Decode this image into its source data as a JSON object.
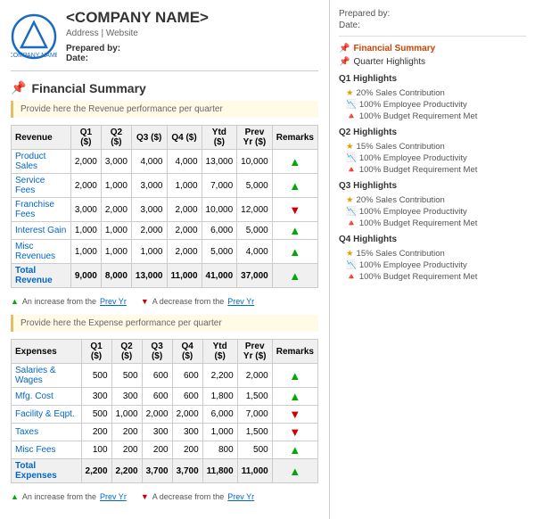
{
  "header": {
    "company_name": "<COMPANY NAME>",
    "address": "Address | Website",
    "prepared_by_label": "Prepared by:",
    "date_label": "Date:",
    "logo_alt": "company-logo"
  },
  "sidebar": {
    "prepared_by_label": "Prepared by:",
    "date_label": "Date:",
    "nav": [
      {
        "id": "financial-summary",
        "label": "Financial Summary",
        "icon": "📌",
        "active": true,
        "indent": 0
      },
      {
        "id": "quarter-highlights",
        "label": "Quarter Highlights",
        "icon": "📌",
        "active": false,
        "indent": 0
      }
    ],
    "quarters": [
      {
        "label": "Q1 Highlights",
        "items": [
          {
            "type": "star",
            "text": "20% Sales Contribution"
          },
          {
            "type": "trend",
            "text": "100% Employee Productivity"
          },
          {
            "type": "warn",
            "text": "100% Budget Requirement Met"
          }
        ]
      },
      {
        "label": "Q2 Highlights",
        "items": [
          {
            "type": "star",
            "text": "15% Sales Contribution"
          },
          {
            "type": "trend",
            "text": "100% Employee Productivity"
          },
          {
            "type": "warn",
            "text": "100% Budget Requirement Met"
          }
        ]
      },
      {
        "label": "Q3 Highlights",
        "items": [
          {
            "type": "star",
            "text": "20% Sales Contribution"
          },
          {
            "type": "trend",
            "text": "100% Employee Productivity"
          },
          {
            "type": "warn",
            "text": "100% Budget Requirement Met"
          }
        ]
      },
      {
        "label": "Q4 Highlights",
        "items": [
          {
            "type": "star",
            "text": "15% Sales Contribution"
          },
          {
            "type": "trend",
            "text": "100% Employee Productivity"
          },
          {
            "type": "warn",
            "text": "100% Budget Requirement Met"
          }
        ]
      }
    ]
  },
  "financial_summary": {
    "title": "Financial Summary",
    "revenue_note": "Provide here the Revenue performance per quarter",
    "revenue_table": {
      "headers": [
        "Revenue",
        "Q1 ($)",
        "Q2 ($)",
        "Q3 ($)",
        "Q4 ($)",
        "Ytd ($)",
        "Prev Yr ($)",
        "Remarks"
      ],
      "rows": [
        {
          "label": "Product Sales",
          "q1": "2,000",
          "q2": "3,000",
          "q3": "4,000",
          "q4": "4,000",
          "ytd": "13,000",
          "prev": "10,000",
          "trend": "up"
        },
        {
          "label": "Service Fees",
          "q1": "2,000",
          "q2": "1,000",
          "q3": "3,000",
          "q4": "1,000",
          "ytd": "7,000",
          "prev": "5,000",
          "trend": "up"
        },
        {
          "label": "Franchise Fees",
          "q1": "3,000",
          "q2": "2,000",
          "q3": "3,000",
          "q4": "2,000",
          "ytd": "10,000",
          "prev": "12,000",
          "trend": "down"
        },
        {
          "label": "Interest Gain",
          "q1": "1,000",
          "q2": "1,000",
          "q3": "2,000",
          "q4": "2,000",
          "ytd": "6,000",
          "prev": "5,000",
          "trend": "up"
        },
        {
          "label": "Misc Revenues",
          "q1": "1,000",
          "q2": "1,000",
          "q3": "1,000",
          "q4": "2,000",
          "ytd": "5,000",
          "prev": "4,000",
          "trend": "up"
        },
        {
          "label": "Total Revenue",
          "q1": "9,000",
          "q2": "8,000",
          "q3": "13,000",
          "q4": "11,000",
          "ytd": "41,000",
          "prev": "37,000",
          "trend": "up",
          "total": true
        }
      ]
    },
    "revenue_marker": {
      "up_text": "An increase from the",
      "up_link": "Prev Yr",
      "down_text": "A decrease from the",
      "down_link": "Prev Yr"
    },
    "expense_note": "Provide here the Expense performance per quarter",
    "expense_table": {
      "headers": [
        "Expenses",
        "Q1 ($)",
        "Q2 ($)",
        "Q3 ($)",
        "Q4 ($)",
        "Ytd ($)",
        "Prev Yr ($)",
        "Remarks"
      ],
      "rows": [
        {
          "label": "Salaries & Wages",
          "q1": "500",
          "q2": "500",
          "q3": "600",
          "q4": "600",
          "ytd": "2,200",
          "prev": "2,000",
          "trend": "up"
        },
        {
          "label": "Mfg. Cost",
          "q1": "300",
          "q2": "300",
          "q3": "600",
          "q4": "600",
          "ytd": "1,800",
          "prev": "1,500",
          "trend": "up"
        },
        {
          "label": "Facility & Eqpt.",
          "q1": "500",
          "q2": "1,000",
          "q3": "2,000",
          "q4": "2,000",
          "ytd": "6,000",
          "prev": "7,000",
          "trend": "down"
        },
        {
          "label": "Taxes",
          "q1": "200",
          "q2": "200",
          "q3": "300",
          "q4": "300",
          "ytd": "1,000",
          "prev": "1,500",
          "trend": "down"
        },
        {
          "label": "Misc Fees",
          "q1": "100",
          "q2": "200",
          "q3": "200",
          "q4": "200",
          "ytd": "800",
          "prev": "500",
          "trend": "up"
        },
        {
          "label": "Total Expenses",
          "q1": "2,200",
          "q2": "2,200",
          "q3": "3,700",
          "q4": "3,700",
          "ytd": "11,800",
          "prev": "11,000",
          "trend": "up",
          "total": true
        }
      ]
    },
    "expense_marker": {
      "up_text": "An increase from the",
      "up_link": "Prev Yr",
      "down_text": "A decrease from the",
      "down_link": "Prev Yr"
    }
  }
}
